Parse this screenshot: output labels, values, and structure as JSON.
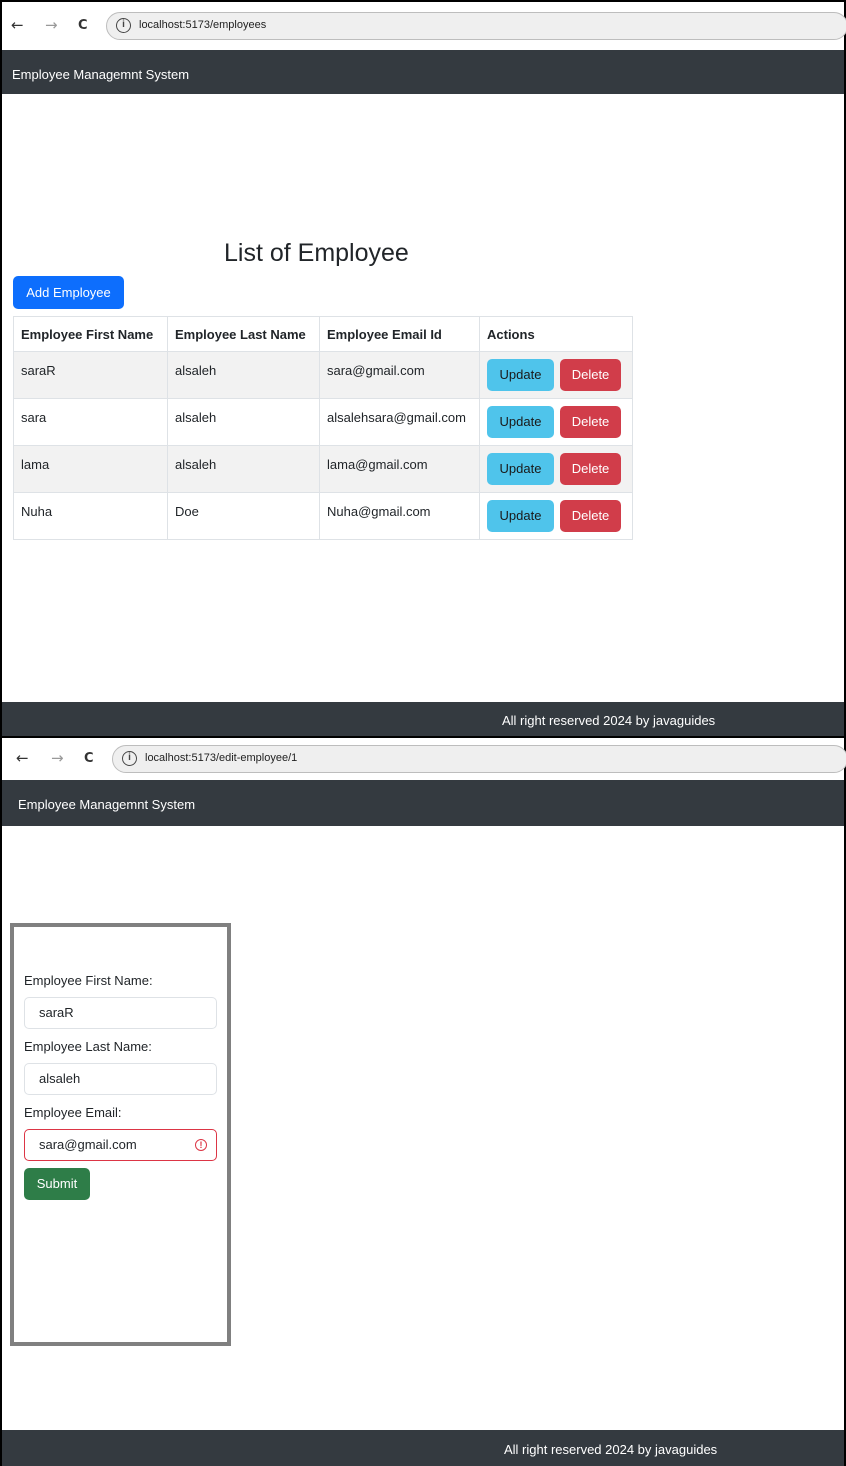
{
  "screen1": {
    "url": "localhost:5173/employees",
    "header_title": "Employee Managemnt System",
    "page_title": "List of Employee",
    "add_button": "Add Employee",
    "columns": [
      "Employee First Name",
      "Employee Last Name",
      "Employee Email Id",
      "Actions"
    ],
    "rows": [
      {
        "first": "saraR",
        "last": "alsaleh",
        "email": "sara@gmail.com"
      },
      {
        "first": "sara",
        "last": "alsaleh",
        "email": "alsalehsara@gmail.com"
      },
      {
        "first": "lama",
        "last": "alsaleh",
        "email": "lama@gmail.com"
      },
      {
        "first": "Nuha",
        "last": "Doe",
        "email": "Nuha@gmail.com"
      }
    ],
    "update_label": "Update",
    "delete_label": "Delete",
    "footer": "All right reserved 2024 by javaguides"
  },
  "screen2": {
    "url": "localhost:5173/edit-employee/1",
    "header_title": "Employee Managemnt System",
    "first_name_label": "Employee First Name:",
    "first_name_value": "saraR",
    "last_name_label": "Employee Last Name:",
    "last_name_value": "alsaleh",
    "email_label": "Employee Email:",
    "email_value": "sara@gmail.com",
    "submit_label": "Submit",
    "footer": "All right reserved 2024 by javaguides"
  },
  "browser": {
    "back_icon": "←",
    "forward_icon": "→",
    "reload_icon": "C",
    "info_icon": "i"
  },
  "colors": {
    "navbar": "#343a40",
    "primary": "#0d6efd",
    "info": "#4fc4eb",
    "danger": "#d13d4a",
    "success": "#2e7d48"
  }
}
